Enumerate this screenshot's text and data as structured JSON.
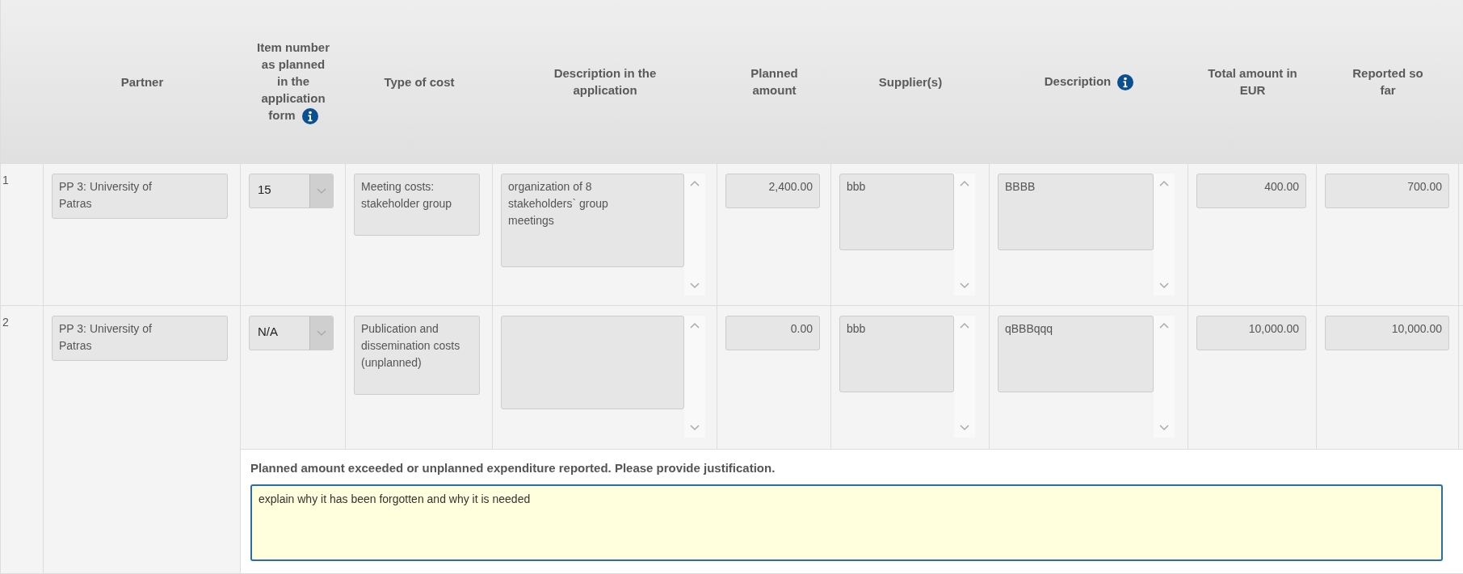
{
  "table": {
    "columns": [
      {
        "label": "Partner",
        "info": false
      },
      {
        "label": "Item number as planned in the application form",
        "info": true
      },
      {
        "label": "Type of cost",
        "info": false
      },
      {
        "label": "Description in the application",
        "info": false
      },
      {
        "label": "Planned amount",
        "info": false
      },
      {
        "label": "Supplier(s)",
        "info": false
      },
      {
        "label": "Description",
        "info": true
      },
      {
        "label": "Total amount in EUR",
        "info": false
      },
      {
        "label": "Reported so far",
        "info": false
      }
    ],
    "rows": [
      {
        "number": "1",
        "partner": "PP 3: University of Patras",
        "item_number": "15",
        "type_of_cost": "Meeting costs: stakeholder group",
        "description_application": "organization of 8 stakeholders` group meetings",
        "planned_amount": "2,400.00",
        "suppliers": "bbb",
        "description": "BBBB",
        "total_amount": "400.00",
        "reported_so_far": "700.00"
      },
      {
        "number": "2",
        "partner": "PP 3: University of Patras",
        "item_number": "N/A",
        "type_of_cost": "Publication and dissemination costs (unplanned)",
        "description_application": "",
        "planned_amount": "0.00",
        "suppliers": "bbb",
        "description": "qBBBqqq",
        "total_amount": "10,000.00",
        "reported_so_far": "10,000.00",
        "justification": {
          "label": "Planned amount exceeded or unplanned expenditure reported. Please provide justification.",
          "value": "explain why it has been forgotten and why it is needed"
        }
      }
    ]
  }
}
